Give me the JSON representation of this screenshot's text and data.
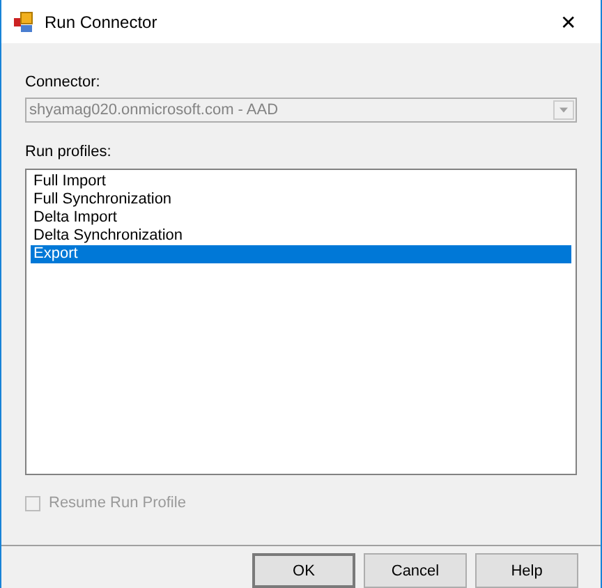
{
  "window": {
    "title": "Run Connector",
    "close": "✕"
  },
  "connector": {
    "label": "Connector:",
    "value": "shyamag020.onmicrosoft.com - AAD",
    "disabled": true
  },
  "run_profiles": {
    "label": "Run profiles:",
    "items": [
      {
        "label": "Full Import",
        "selected": false
      },
      {
        "label": "Full Synchronization",
        "selected": false
      },
      {
        "label": "Delta Import",
        "selected": false
      },
      {
        "label": "Delta Synchronization",
        "selected": false
      },
      {
        "label": "Export",
        "selected": true
      }
    ]
  },
  "resume_run_profile": {
    "label": "Resume Run Profile",
    "checked": false,
    "disabled": true
  },
  "buttons": [
    {
      "label": "OK",
      "default": true
    },
    {
      "label": "Cancel",
      "default": false
    },
    {
      "label": "Help",
      "default": false
    }
  ]
}
